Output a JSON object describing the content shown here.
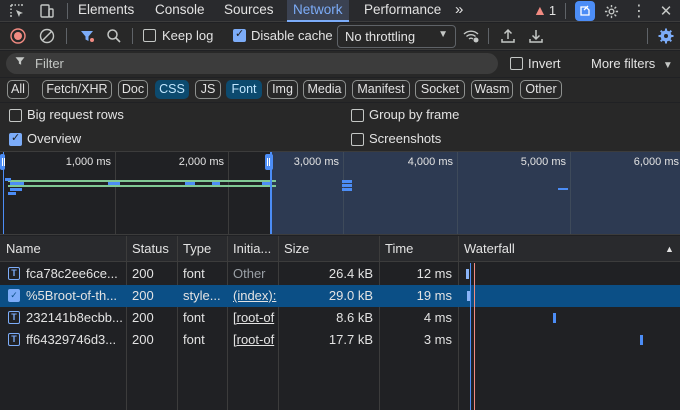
{
  "tabs": [
    {
      "label": "Elements",
      "active": false
    },
    {
      "label": "Console",
      "active": false
    },
    {
      "label": "Sources",
      "active": false
    },
    {
      "label": "Network",
      "active": true
    },
    {
      "label": "Performance",
      "active": false
    }
  ],
  "tab_overflow": "»",
  "issues_count": "1",
  "toolbar": {
    "preserve_log": {
      "label": "Keep log",
      "checked": false
    },
    "disable_cache": {
      "label": "Disable cache",
      "checked": true
    },
    "throttling": "No throttling"
  },
  "filter": {
    "placeholder": "Filter",
    "invert_label": "Invert",
    "more_filters_label": "More filters"
  },
  "type_filters": [
    {
      "label": "All",
      "active": false
    },
    {
      "label": "Fetch/XHR",
      "active": false
    },
    {
      "label": "Doc",
      "active": false
    },
    {
      "label": "CSS",
      "active": true
    },
    {
      "label": "JS",
      "active": false
    },
    {
      "label": "Font",
      "active": true
    },
    {
      "label": "Img",
      "active": false
    },
    {
      "label": "Media",
      "active": false
    },
    {
      "label": "Manifest",
      "active": false
    },
    {
      "label": "Socket",
      "active": false
    },
    {
      "label": "Wasm",
      "active": false
    },
    {
      "label": "Other",
      "active": false
    }
  ],
  "options": {
    "big_request_rows": {
      "label": "Big request rows",
      "checked": false
    },
    "group_by_frame": {
      "label": "Group by frame",
      "checked": false
    },
    "overview": {
      "label": "Overview",
      "checked": true
    },
    "screenshots": {
      "label": "Screenshots",
      "checked": false
    }
  },
  "overview": {
    "tick_labels": [
      "1,000 ms",
      "2,000 ms",
      "3,000 ms",
      "4,000 ms",
      "5,000 ms",
      "6,000 ms"
    ]
  },
  "table": {
    "columns": [
      "Name",
      "Status",
      "Type",
      "Initia...",
      "Size",
      "Time",
      "Waterfall"
    ],
    "rows": [
      {
        "name": "fca78c2ee6ce...",
        "status": "200",
        "type": "font",
        "initiator": "Other",
        "size": "26.4 kB",
        "time": "12 ms",
        "icon": "font-file-icon",
        "selected": false
      },
      {
        "name": "%5Broot-of-th...",
        "status": "200",
        "type": "style...",
        "initiator": "(index):",
        "size": "29.0 kB",
        "time": "19 ms",
        "icon": "stylesheet-icon",
        "selected": true
      },
      {
        "name": "232141b8ecbb...",
        "status": "200",
        "type": "font",
        "initiator": "[root-of",
        "size": "8.6 kB",
        "time": "4 ms",
        "icon": "font-file-icon",
        "selected": false
      },
      {
        "name": "ff64329746d3...",
        "status": "200",
        "type": "font",
        "initiator": "[root-of",
        "size": "17.7 kB",
        "time": "3 ms",
        "icon": "font-file-icon",
        "selected": false
      }
    ]
  },
  "colors": {
    "accent": "#7cacf8",
    "selected_row": "#0b4f86",
    "active_chip": "#0c4a6e",
    "overview_selection": "#2d3a52"
  }
}
